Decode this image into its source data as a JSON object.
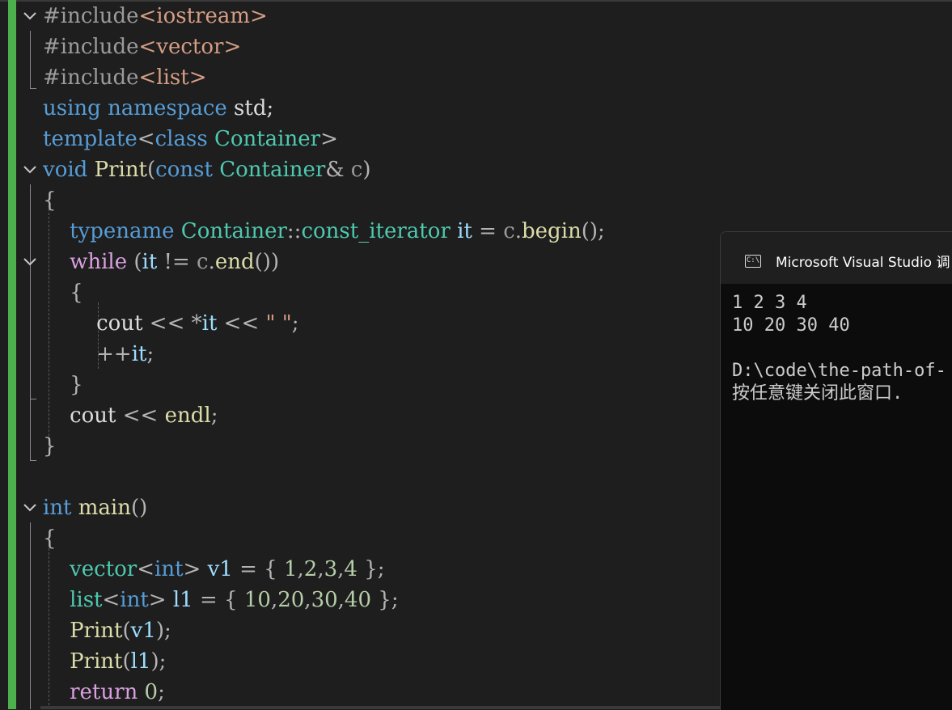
{
  "editor": {
    "lines": [
      [
        {
          "t": "#include",
          "c": "preproc"
        },
        {
          "t": "<iostream>",
          "c": "include"
        }
      ],
      [
        {
          "t": "#include",
          "c": "preproc"
        },
        {
          "t": "<vector>",
          "c": "include"
        }
      ],
      [
        {
          "t": "#include",
          "c": "preproc"
        },
        {
          "t": "<list>",
          "c": "include"
        }
      ],
      [
        {
          "t": "using",
          "c": "keyword"
        },
        {
          "t": " ",
          "c": "plain"
        },
        {
          "t": "namespace",
          "c": "keyword"
        },
        {
          "t": " std;",
          "c": "plain"
        }
      ],
      [
        {
          "t": "template",
          "c": "keyword"
        },
        {
          "t": "<",
          "c": "punct"
        },
        {
          "t": "class",
          "c": "keyword"
        },
        {
          "t": " ",
          "c": "plain"
        },
        {
          "t": "Container",
          "c": "type"
        },
        {
          "t": ">",
          "c": "punct"
        }
      ],
      [
        {
          "t": "void",
          "c": "keyword"
        },
        {
          "t": " ",
          "c": "plain"
        },
        {
          "t": "Print",
          "c": "func"
        },
        {
          "t": "(",
          "c": "punct"
        },
        {
          "t": "const",
          "c": "keyword"
        },
        {
          "t": " ",
          "c": "plain"
        },
        {
          "t": "Container",
          "c": "type"
        },
        {
          "t": "& ",
          "c": "punct"
        },
        {
          "t": "c",
          "c": "param"
        },
        {
          "t": ")",
          "c": "punct"
        }
      ],
      [
        {
          "t": "{",
          "c": "punct"
        }
      ],
      [
        {
          "t": "    ",
          "c": "plain"
        },
        {
          "t": "typename",
          "c": "keyword"
        },
        {
          "t": " ",
          "c": "plain"
        },
        {
          "t": "Container",
          "c": "type"
        },
        {
          "t": "::",
          "c": "punct"
        },
        {
          "t": "const_iterator",
          "c": "type"
        },
        {
          "t": " ",
          "c": "plain"
        },
        {
          "t": "it",
          "c": "var"
        },
        {
          "t": " = ",
          "c": "punct"
        },
        {
          "t": "c",
          "c": "param"
        },
        {
          "t": ".",
          "c": "punct"
        },
        {
          "t": "begin",
          "c": "func"
        },
        {
          "t": "();",
          "c": "punct"
        }
      ],
      [
        {
          "t": "    ",
          "c": "plain"
        },
        {
          "t": "while",
          "c": "control"
        },
        {
          "t": " (",
          "c": "punct"
        },
        {
          "t": "it",
          "c": "var"
        },
        {
          "t": " != ",
          "c": "punct"
        },
        {
          "t": "c",
          "c": "param"
        },
        {
          "t": ".",
          "c": "punct"
        },
        {
          "t": "end",
          "c": "func"
        },
        {
          "t": "())",
          "c": "punct"
        }
      ],
      [
        {
          "t": "    ",
          "c": "plain"
        },
        {
          "t": "{",
          "c": "punct"
        }
      ],
      [
        {
          "t": "        ",
          "c": "plain"
        },
        {
          "t": "cout",
          "c": "plain"
        },
        {
          "t": " << ",
          "c": "punct"
        },
        {
          "t": "*",
          "c": "punct"
        },
        {
          "t": "it",
          "c": "var"
        },
        {
          "t": " << ",
          "c": "punct"
        },
        {
          "t": "\" \"",
          "c": "str"
        },
        {
          "t": ";",
          "c": "punct"
        }
      ],
      [
        {
          "t": "        ",
          "c": "plain"
        },
        {
          "t": "++",
          "c": "punct"
        },
        {
          "t": "it",
          "c": "var"
        },
        {
          "t": ";",
          "c": "punct"
        }
      ],
      [
        {
          "t": "    ",
          "c": "plain"
        },
        {
          "t": "}",
          "c": "punct"
        }
      ],
      [
        {
          "t": "    ",
          "c": "plain"
        },
        {
          "t": "cout",
          "c": "plain"
        },
        {
          "t": " << ",
          "c": "punct"
        },
        {
          "t": "endl",
          "c": "func"
        },
        {
          "t": ";",
          "c": "punct"
        }
      ],
      [
        {
          "t": "}",
          "c": "punct"
        }
      ],
      [],
      [
        {
          "t": "int",
          "c": "keyword"
        },
        {
          "t": " ",
          "c": "plain"
        },
        {
          "t": "main",
          "c": "func"
        },
        {
          "t": "()",
          "c": "punct"
        }
      ],
      [
        {
          "t": "{",
          "c": "punct"
        }
      ],
      [
        {
          "t": "    ",
          "c": "plain"
        },
        {
          "t": "vector",
          "c": "type"
        },
        {
          "t": "<",
          "c": "punct"
        },
        {
          "t": "int",
          "c": "keyword"
        },
        {
          "t": "> ",
          "c": "punct"
        },
        {
          "t": "v1",
          "c": "var"
        },
        {
          "t": " = { ",
          "c": "punct"
        },
        {
          "t": "1",
          "c": "num"
        },
        {
          "t": ",",
          "c": "punct"
        },
        {
          "t": "2",
          "c": "num"
        },
        {
          "t": ",",
          "c": "punct"
        },
        {
          "t": "3",
          "c": "num"
        },
        {
          "t": ",",
          "c": "punct"
        },
        {
          "t": "4",
          "c": "num"
        },
        {
          "t": " };",
          "c": "punct"
        }
      ],
      [
        {
          "t": "    ",
          "c": "plain"
        },
        {
          "t": "list",
          "c": "type"
        },
        {
          "t": "<",
          "c": "punct"
        },
        {
          "t": "int",
          "c": "keyword"
        },
        {
          "t": "> ",
          "c": "punct"
        },
        {
          "t": "l1",
          "c": "var"
        },
        {
          "t": " = { ",
          "c": "punct"
        },
        {
          "t": "10",
          "c": "num"
        },
        {
          "t": ",",
          "c": "punct"
        },
        {
          "t": "20",
          "c": "num"
        },
        {
          "t": ",",
          "c": "punct"
        },
        {
          "t": "30",
          "c": "num"
        },
        {
          "t": ",",
          "c": "punct"
        },
        {
          "t": "40",
          "c": "num"
        },
        {
          "t": " };",
          "c": "punct"
        }
      ],
      [
        {
          "t": "    ",
          "c": "plain"
        },
        {
          "t": "Print",
          "c": "func"
        },
        {
          "t": "(",
          "c": "punct"
        },
        {
          "t": "v1",
          "c": "var"
        },
        {
          "t": ");",
          "c": "punct"
        }
      ],
      [
        {
          "t": "    ",
          "c": "plain"
        },
        {
          "t": "Print",
          "c": "func"
        },
        {
          "t": "(",
          "c": "punct"
        },
        {
          "t": "l1",
          "c": "var"
        },
        {
          "t": ");",
          "c": "punct"
        }
      ],
      [
        {
          "t": "    ",
          "c": "plain"
        },
        {
          "t": "return",
          "c": "control"
        },
        {
          "t": " ",
          "c": "plain"
        },
        {
          "t": "0",
          "c": "num"
        },
        {
          "t": ";",
          "c": "punct"
        }
      ]
    ],
    "fold_lines": [
      0,
      5,
      8,
      16
    ],
    "colors": {
      "background": "#1e1e1e",
      "change_bar": "#4cb04c",
      "keyword": "#569cd6",
      "control": "#d8a0df",
      "type": "#4ec9b0",
      "func": "#dcdcaa",
      "var": "#9cdcfe",
      "num": "#b5cea8",
      "str": "#d69d85"
    }
  },
  "console": {
    "icon_text": "C:\\",
    "title": "Microsoft Visual Studio 调",
    "output_lines": [
      "1 2 3 4",
      "10 20 30 40",
      "",
      "D:\\code\\the-path-of-",
      "按任意键关闭此窗口."
    ]
  }
}
